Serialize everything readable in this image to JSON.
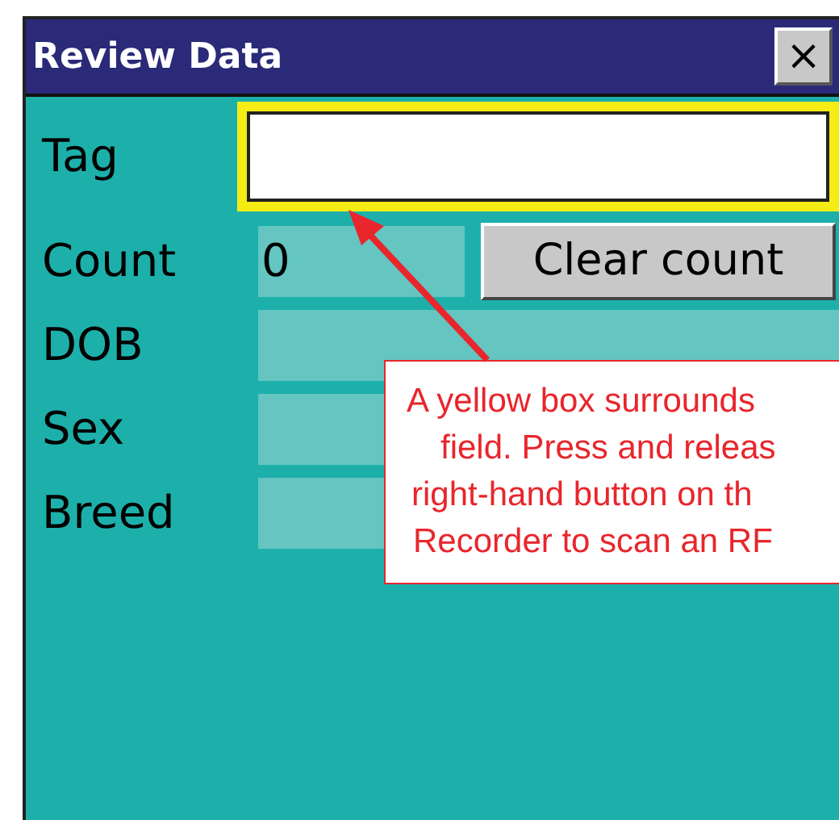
{
  "window": {
    "title": "Review Data",
    "close": "×"
  },
  "tag": {
    "label": "Tag",
    "highlighted": true
  },
  "fields": [
    {
      "label": "Count",
      "value": "0",
      "button": "Clear count"
    },
    {
      "label": "DOB"
    },
    {
      "label": "Sex"
    },
    {
      "label": "Breed"
    }
  ],
  "callout": {
    "lines": [
      "A yellow box surrounds",
      "field. Press and releas",
      "right-hand button on th",
      "Recorder to scan an RF"
    ]
  }
}
